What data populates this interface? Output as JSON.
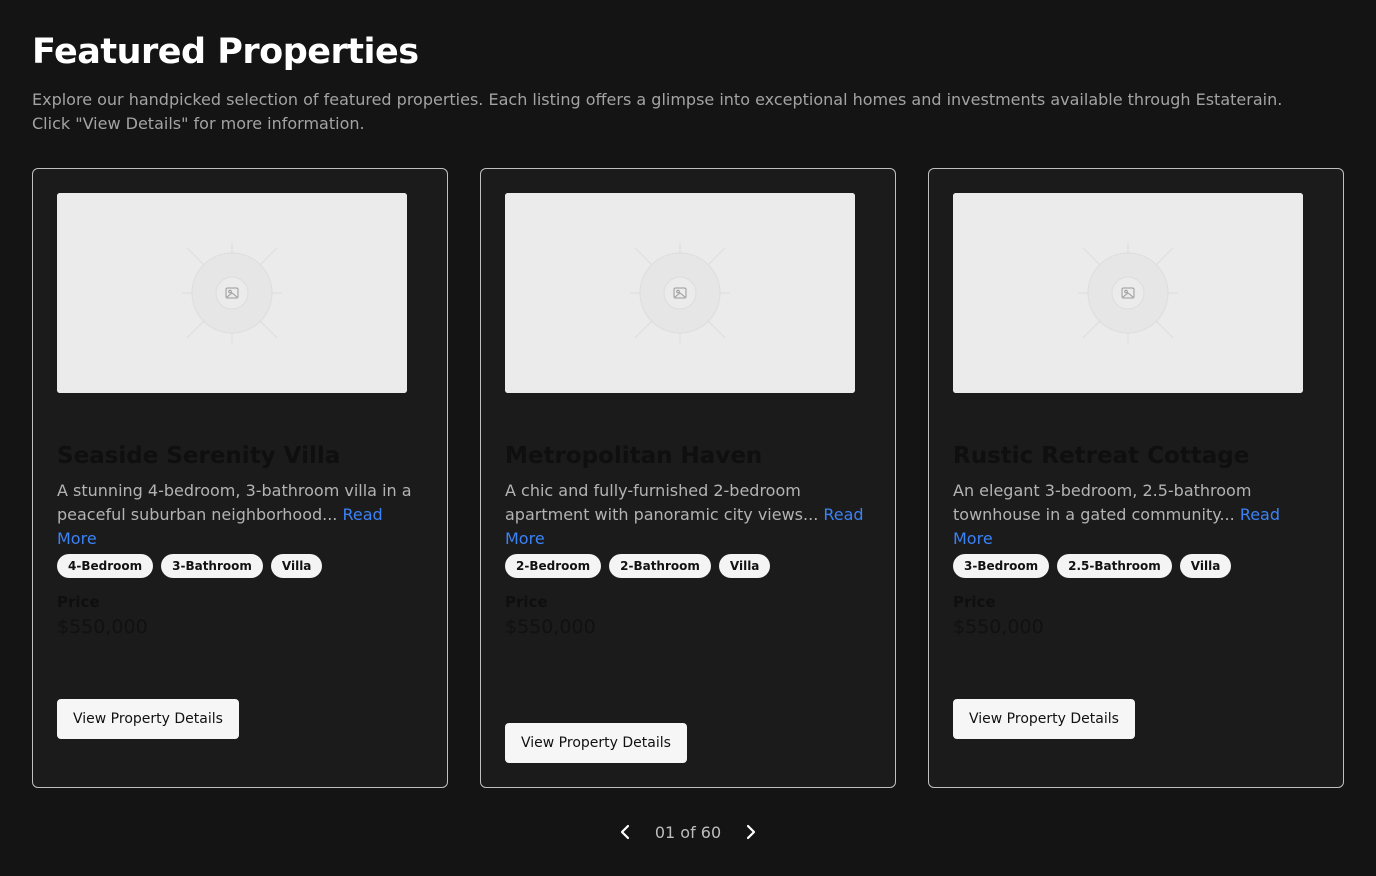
{
  "header": {
    "title": "Featured Properties",
    "intro": "Explore our handpicked selection of featured properties. Each listing offers a glimpse into exceptional homes and investments available through Estaterain. Click \"View Details\" for more information."
  },
  "cards": [
    {
      "title": "Seaside Serenity Villa",
      "description": "A stunning 4-bedroom, 3-bathroom villa in a peaceful suburban neighborhood...",
      "read_more": "Read More",
      "tags": [
        "4-Bedroom",
        "3-Bathroom",
        "Villa"
      ],
      "price_label": "Price",
      "price": "$550,000",
      "button_label": "View Property Details",
      "image_icon": "image-placeholder-icon"
    },
    {
      "title": "Metropolitan Haven",
      "description": "A chic and fully-furnished 2-bedroom apartment with panoramic city views...",
      "read_more": "Read More",
      "tags": [
        "2-Bedroom",
        "2-Bathroom",
        "Villa"
      ],
      "price_label": "Price",
      "price": "$550,000",
      "button_label": "View Property Details",
      "image_icon": "image-placeholder-icon"
    },
    {
      "title": "Rustic Retreat Cottage",
      "description": "An elegant 3-bedroom, 2.5-bathroom townhouse in a gated community...",
      "read_more": "Read More",
      "tags": [
        "3-Bedroom",
        "2.5-Bathroom",
        "Villa"
      ],
      "price_label": "Price",
      "price": "$550,000",
      "button_label": "View Property Details",
      "image_icon": "image-placeholder-icon"
    }
  ],
  "pagination": {
    "indicator": "01 of 60",
    "prev_icon": "chevron-left-icon",
    "next_icon": "chevron-right-icon"
  },
  "colors": {
    "background": "#141414",
    "card_background": "#1b1b1b",
    "card_border": "#bfbfbf",
    "link": "#3b82f6",
    "chip_background": "#f4f4f4",
    "button_background": "#f6f6f6"
  }
}
